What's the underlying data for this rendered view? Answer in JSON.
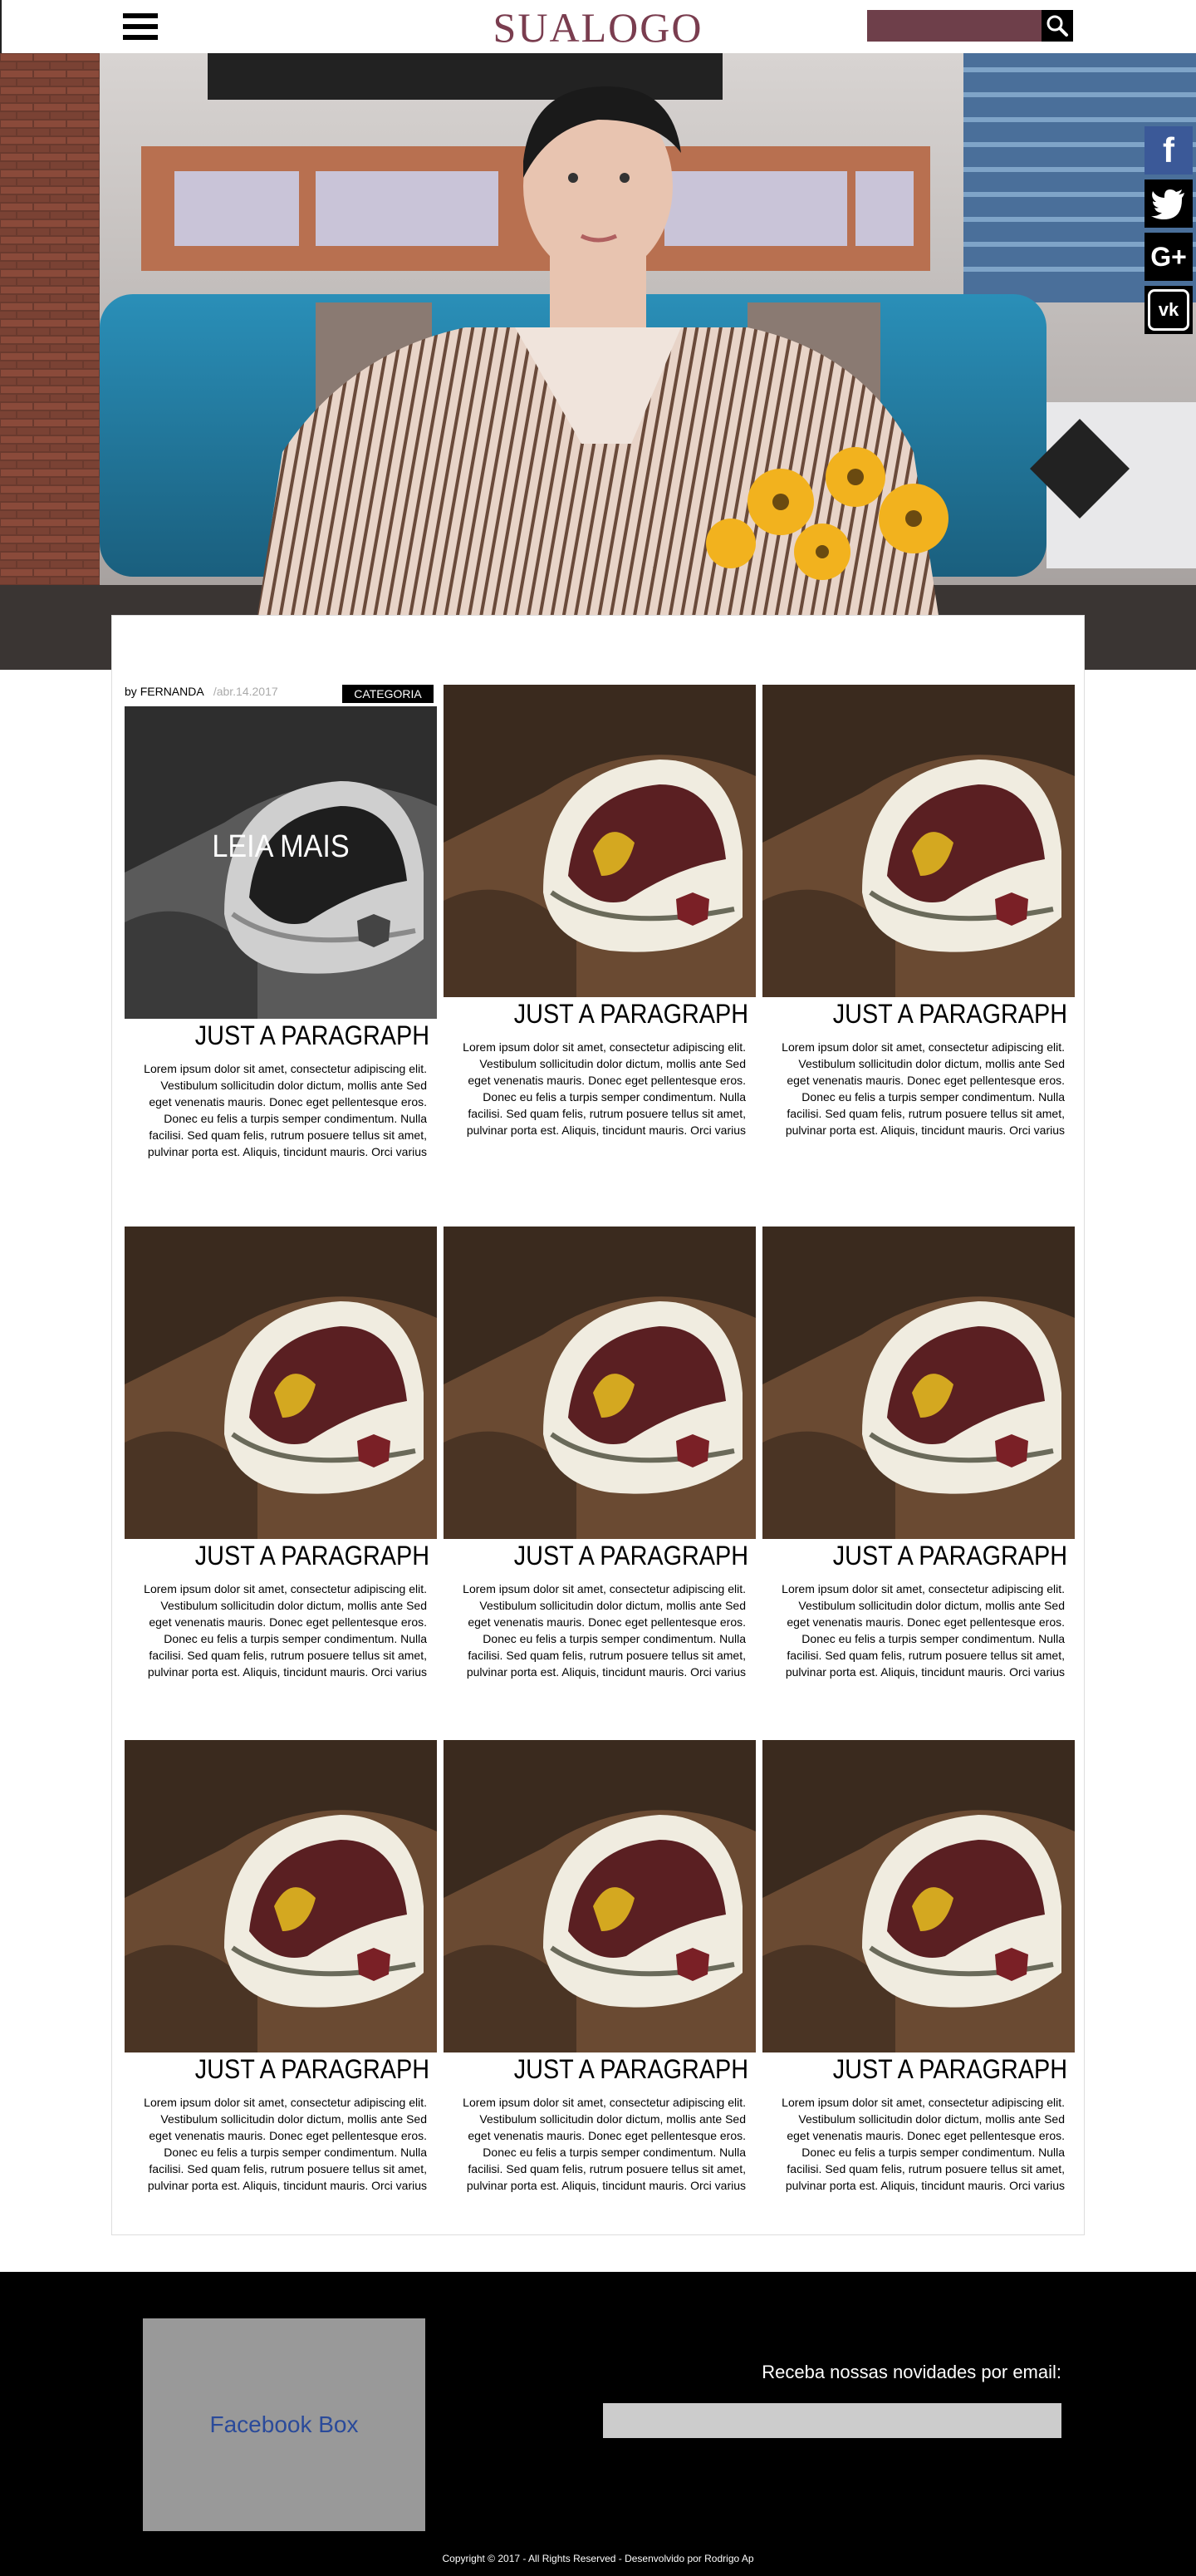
{
  "header": {
    "logo": "SUALOGO",
    "search_placeholder": ""
  },
  "meta": {
    "by": "by",
    "author": "FERNANDA",
    "date": "/abr.14.2017",
    "category": "CATEGORIA"
  },
  "featured": {
    "overlay": "LEIA MAIS"
  },
  "posts": [
    {
      "title": "JUST A PARAGRAPH",
      "body": "Lorem ipsum dolor sit amet, consectetur adipiscing elit. Vestibulum sollicitudin dolor dictum, mollis ante Sed eget venenatis mauris. Donec eget pellentesque eros. Donec eu felis a turpis semper condimentum. Nulla facilisi. Sed quam felis, rutrum posuere tellus sit amet, pulvinar porta est. Aliquis, tincidunt mauris. Orci varius"
    },
    {
      "title": "JUST A PARAGRAPH",
      "body": "Lorem ipsum dolor sit amet, consectetur adipiscing elit. Vestibulum sollicitudin dolor dictum, mollis ante Sed eget venenatis mauris. Donec eget pellentesque eros. Donec eu felis a turpis semper condimentum. Nulla facilisi. Sed quam felis, rutrum posuere tellus sit amet, pulvinar porta est. Aliquis, tincidunt mauris. Orci varius"
    },
    {
      "title": "JUST A PARAGRAPH",
      "body": "Lorem ipsum dolor sit amet, consectetur adipiscing elit. Vestibulum sollicitudin dolor dictum, mollis ante Sed eget venenatis mauris. Donec eget pellentesque eros. Donec eu felis a turpis semper condimentum. Nulla facilisi. Sed quam felis, rutrum posuere tellus sit amet, pulvinar porta est. Aliquis, tincidunt mauris. Orci varius"
    },
    {
      "title": "JUST A PARAGRAPH",
      "body": "Lorem ipsum dolor sit amet, consectetur adipiscing elit. Vestibulum sollicitudin dolor dictum, mollis ante Sed eget venenatis mauris. Donec eget pellentesque eros. Donec eu felis a turpis semper condimentum. Nulla facilisi. Sed quam felis, rutrum posuere tellus sit amet, pulvinar porta est. Aliquis, tincidunt mauris. Orci varius"
    },
    {
      "title": "JUST A PARAGRAPH",
      "body": "Lorem ipsum dolor sit amet, consectetur adipiscing elit. Vestibulum sollicitudin dolor dictum, mollis ante Sed eget venenatis mauris. Donec eget pellentesque eros. Donec eu felis a turpis semper condimentum. Nulla facilisi. Sed quam felis, rutrum posuere tellus sit amet, pulvinar porta est. Aliquis, tincidunt mauris. Orci varius"
    },
    {
      "title": "JUST A PARAGRAPH",
      "body": "Lorem ipsum dolor sit amet, consectetur adipiscing elit. Vestibulum sollicitudin dolor dictum, mollis ante Sed eget venenatis mauris. Donec eget pellentesque eros. Donec eu felis a turpis semper condimentum. Nulla facilisi. Sed quam felis, rutrum posuere tellus sit amet, pulvinar porta est. Aliquis, tincidunt mauris. Orci varius"
    },
    {
      "title": "JUST A PARAGRAPH",
      "body": "Lorem ipsum dolor sit amet, consectetur adipiscing elit. Vestibulum sollicitudin dolor dictum, mollis ante Sed eget venenatis mauris. Donec eget pellentesque eros. Donec eu felis a turpis semper condimentum. Nulla facilisi. Sed quam felis, rutrum posuere tellus sit amet, pulvinar porta est. Aliquis, tincidunt mauris. Orci varius"
    },
    {
      "title": "JUST A PARAGRAPH",
      "body": "Lorem ipsum dolor sit amet, consectetur adipiscing elit. Vestibulum sollicitudin dolor dictum, mollis ante Sed eget venenatis mauris. Donec eget pellentesque eros. Donec eu felis a turpis semper condimentum. Nulla facilisi. Sed quam felis, rutrum posuere tellus sit amet, pulvinar porta est. Aliquis, tincidunt mauris. Orci varius"
    },
    {
      "title": "JUST A PARAGRAPH",
      "body": "Lorem ipsum dolor sit amet, consectetur adipiscing elit. Vestibulum sollicitudin dolor dictum, mollis ante Sed eget venenatis mauris. Donec eget pellentesque eros. Donec eu felis a turpis semper condimentum. Nulla facilisi. Sed quam felis, rutrum posuere tellus sit amet, pulvinar porta est. Aliquis, tincidunt mauris. Orci varius"
    }
  ],
  "social": [
    {
      "icon": "facebook-icon",
      "glyph": "f"
    },
    {
      "icon": "twitter-icon",
      "glyph": "t"
    },
    {
      "icon": "google-plus-icon",
      "glyph": "G+"
    },
    {
      "icon": "vk-icon",
      "glyph": "vk"
    }
  ],
  "footer": {
    "facebook_box": "Facebook Box",
    "newsletter_label": "Receba nossas novidades por email:",
    "newsletter_placeholder": "",
    "copyright": "Copyright © 2017 - All Rights Reserved - Desenvolvido por Rodrigo Ap"
  },
  "colors": {
    "logo": "#7a3d4f",
    "search_bg": "#6e3f4a",
    "facebook": "#3b5998",
    "footer_bg": "#000000"
  }
}
